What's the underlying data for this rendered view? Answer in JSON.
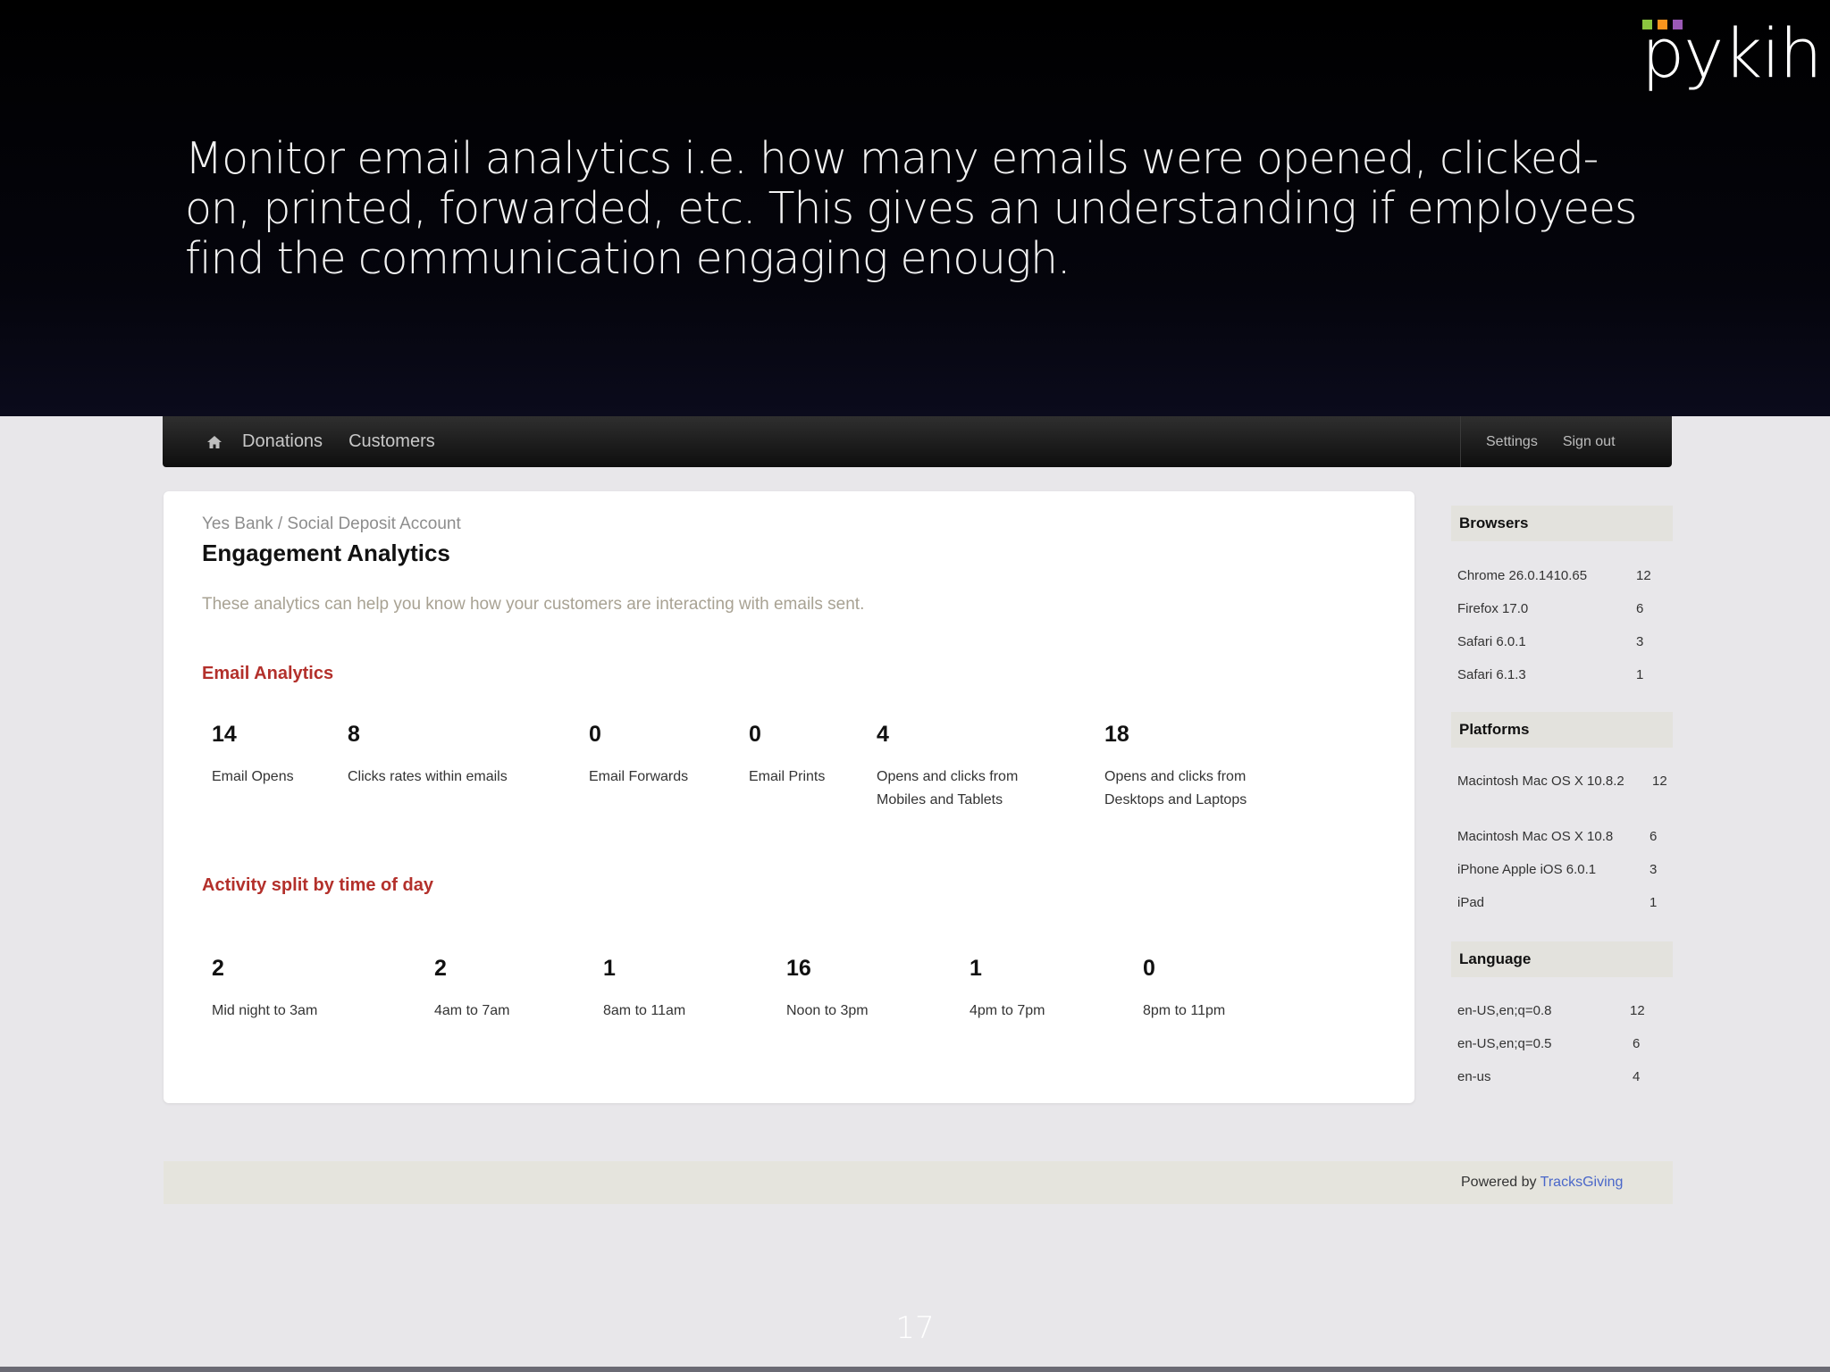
{
  "slide": {
    "caption": "Monitor email analytics i.e. how many emails were opened, clicked-on, printed, forwarded, etc. This gives an understanding if employees find the communication engaging enough.",
    "logo_text": "pykih",
    "logo_colors": [
      "#8bc53f",
      "#f7941d",
      "#9b59b6"
    ],
    "page_number": "17"
  },
  "navbar": {
    "home_icon": "home-icon",
    "links": [
      "Donations",
      "Customers"
    ],
    "right_links": [
      "Settings",
      "Sign out"
    ]
  },
  "main": {
    "breadcrumb": "Yes Bank / Social Deposit Account",
    "title": "Engagement Analytics",
    "description": "These analytics can help you know how your customers are interacting with emails sent.",
    "email_section_title": "Email Analytics",
    "email_metrics": [
      {
        "value": "14",
        "label": "Email Opens"
      },
      {
        "value": "8",
        "label": "Clicks rates within emails"
      },
      {
        "value": "0",
        "label": "Email Forwards"
      },
      {
        "value": "0",
        "label": "Email Prints"
      },
      {
        "value": "4",
        "label": "Opens and clicks from Mobiles and Tablets"
      },
      {
        "value": "18",
        "label": "Opens and clicks from Desktops and Laptops"
      }
    ],
    "time_section_title": "Activity split by time of day",
    "time_metrics": [
      {
        "value": "2",
        "label": "Mid night to 3am"
      },
      {
        "value": "2",
        "label": "4am to 7am"
      },
      {
        "value": "1",
        "label": "8am to 11am"
      },
      {
        "value": "16",
        "label": "Noon to 3pm"
      },
      {
        "value": "1",
        "label": "4pm to 7pm"
      },
      {
        "value": "0",
        "label": "8pm to 11pm"
      }
    ]
  },
  "sidebar": {
    "browsers": {
      "title": "Browsers",
      "rows": [
        {
          "name": "Chrome 26.0.1410.65",
          "count": "12"
        },
        {
          "name": "Firefox 17.0",
          "count": "6"
        },
        {
          "name": "Safari 6.0.1",
          "count": "3"
        },
        {
          "name": "Safari 6.1.3",
          "count": "1"
        }
      ]
    },
    "platforms": {
      "title": "Platforms",
      "rows": [
        {
          "name": "Macintosh Mac OS X 10.8.2",
          "count": "12"
        },
        {
          "name": "Macintosh Mac OS X 10.8",
          "count": "6"
        },
        {
          "name": "iPhone Apple iOS 6.0.1",
          "count": "3"
        },
        {
          "name": "iPad",
          "count": "1"
        }
      ]
    },
    "language": {
      "title": "Language",
      "rows": [
        {
          "name": "en-US,en;q=0.8",
          "count": "12"
        },
        {
          "name": "en-US,en;q=0.5",
          "count": "6"
        },
        {
          "name": "en-us",
          "count": "4"
        }
      ]
    }
  },
  "footer": {
    "powered_by": "Powered by",
    "link": "TracksGiving"
  },
  "colors": {
    "accent_red": "#b3302b",
    "link_blue": "#4a67c9",
    "navbar": "#1b1b1b"
  }
}
